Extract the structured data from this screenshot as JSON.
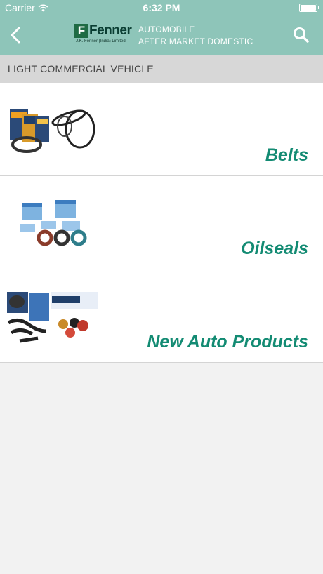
{
  "status_bar": {
    "carrier": "Carrier",
    "time": "6:32 PM"
  },
  "header": {
    "logo": {
      "mark": "F",
      "word": "Fenner",
      "tagline": "J.K. Fenner (India) Limited"
    },
    "title_line1": "AUTOMOBILE",
    "title_line2": "AFTER MARKET DOMESTIC",
    "back_icon": "chevron-left-icon",
    "search_icon": "search-icon"
  },
  "section_title": "LIGHT COMMERCIAL VEHICLE",
  "categories": [
    {
      "label": "Belts"
    },
    {
      "label": "Oilseals"
    },
    {
      "label": "New Auto Products"
    }
  ],
  "colors": {
    "header": "#8ec5b9",
    "accent": "#138b73",
    "section": "#d7d7d7",
    "background": "#f2f2f2"
  }
}
